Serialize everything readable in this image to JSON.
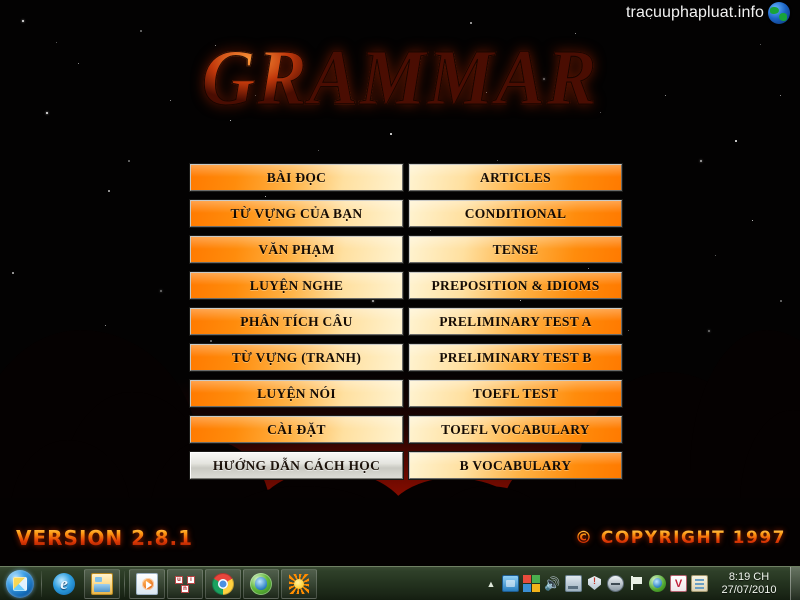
{
  "app": {
    "title": "GRAMMAR",
    "version_label": "VERSION 2.8.1",
    "copyright_label": "© COPYRIGHT 1997",
    "colors": {
      "button_orange": "#ff7a00",
      "button_cream": "#fff3d0",
      "title_flame": "#c1380b",
      "background": "#030202",
      "horizon_glow": "#c81900"
    }
  },
  "watermark": {
    "text": "tracuuphapluat.info",
    "icon": "globe-icon"
  },
  "menu": {
    "left_column": [
      {
        "label": "BÀI ĐỌC",
        "state": "normal"
      },
      {
        "label": "TỪ VỰNG CỦA BẠN",
        "state": "normal"
      },
      {
        "label": "VĂN PHẠM",
        "state": "normal"
      },
      {
        "label": "LUYỆN NGHE",
        "state": "normal"
      },
      {
        "label": "PHÂN TÍCH CÂU",
        "state": "normal"
      },
      {
        "label": "TỪ VỰNG (TRANH)",
        "state": "normal"
      },
      {
        "label": "LUYỆN NÓI",
        "state": "normal"
      },
      {
        "label": "CÀI ĐẶT",
        "state": "normal"
      },
      {
        "label": "HƯỚNG DẪN CÁCH HỌC",
        "state": "active"
      }
    ],
    "right_column": [
      {
        "label": "ARTICLES",
        "state": "normal"
      },
      {
        "label": "CONDITIONAL",
        "state": "normal"
      },
      {
        "label": "TENSE",
        "state": "normal"
      },
      {
        "label": "PREPOSITION & IDIOMS",
        "state": "normal"
      },
      {
        "label": "PRELIMINARY TEST A",
        "state": "normal"
      },
      {
        "label": "PRELIMINARY TEST B",
        "state": "normal"
      },
      {
        "label": "TOEFL TEST",
        "state": "normal"
      },
      {
        "label": "TOEFL VOCABULARY",
        "state": "normal"
      },
      {
        "label": "B VOCABULARY",
        "state": "normal"
      }
    ]
  },
  "taskbar": {
    "start_button": "start-orb",
    "quick_launch": [
      {
        "name": "internet-explorer-icon"
      },
      {
        "name": "windows-explorer-icon"
      }
    ],
    "tasks": [
      {
        "name": "media-player-icon"
      },
      {
        "name": "unikey-icon"
      },
      {
        "name": "google-chrome-icon"
      },
      {
        "name": "internet-download-manager-icon"
      },
      {
        "name": "grammar-app-icon"
      }
    ],
    "tray": {
      "overflow_arrow": "▲",
      "icons": [
        {
          "name": "tray-display-icon"
        },
        {
          "name": "tray-windows-icon"
        },
        {
          "name": "tray-volume-icon"
        },
        {
          "name": "tray-network-icon"
        },
        {
          "name": "tray-action-center-icon"
        },
        {
          "name": "tray-circle-icon"
        },
        {
          "name": "tray-flag-icon"
        },
        {
          "name": "tray-idm-icon"
        },
        {
          "name": "tray-v-icon"
        },
        {
          "name": "tray-notepad-icon"
        }
      ]
    },
    "clock": {
      "time": "8:19 CH",
      "date": "27/07/2010"
    },
    "show_desktop": "show-desktop-button"
  }
}
